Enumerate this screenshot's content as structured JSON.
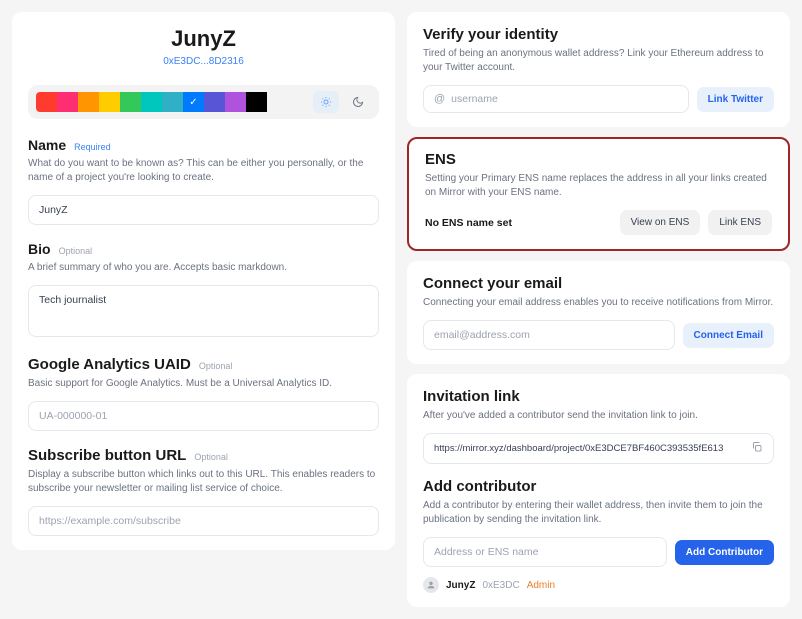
{
  "profile": {
    "display_name": "JunyZ",
    "wallet": "0xE3DC...8D2316"
  },
  "palette": {
    "colors": [
      "#ff3b30",
      "#ff2d72",
      "#ff9500",
      "#ffcc00",
      "#34c759",
      "#00c7be",
      "#30B0C7",
      "#007aff",
      "#5856d6",
      "#af52de",
      "#000000"
    ],
    "selected_index": 7
  },
  "name": {
    "title": "Name",
    "tag": "Required",
    "desc": "What do you want to be known as? This can be either you personally, or the name of a project you're looking to create.",
    "value": "JunyZ"
  },
  "bio": {
    "title": "Bio",
    "tag": "Optional",
    "desc": "A brief summary of who you are. Accepts basic markdown.",
    "value": "Tech journalist"
  },
  "ga": {
    "title": "Google Analytics UAID",
    "tag": "Optional",
    "desc": "Basic support for Google Analytics. Must be a Universal Analytics ID.",
    "placeholder": "UA-000000-01"
  },
  "sub": {
    "title": "Subscribe button URL",
    "tag": "Optional",
    "desc": "Display a subscribe button which links out to this URL. This enables readers to subscribe your newsletter or mailing list service of choice.",
    "placeholder": "https://example.com/subscribe"
  },
  "verify": {
    "title": "Verify your identity",
    "desc": "Tired of being an anonymous wallet address? Link your Ethereum address to your Twitter account.",
    "placeholder": "username",
    "button": "Link Twitter"
  },
  "ens": {
    "title": "ENS",
    "desc": "Setting your Primary ENS name replaces the address in all your links created on Mirror with your ENS name.",
    "status": "No ENS name set",
    "view_btn": "View on ENS",
    "link_btn": "Link ENS"
  },
  "email": {
    "title": "Connect your email",
    "desc": "Connecting your email address enables you to receive notifications from Mirror.",
    "placeholder": "email@address.com",
    "button": "Connect Email"
  },
  "invite": {
    "title": "Invitation link",
    "desc": "After you've added a contributor send the invitation link to join.",
    "url": "https://mirror.xyz/dashboard/project/0xE3DCE7BF460C393535fE613"
  },
  "add": {
    "title": "Add contributor",
    "desc": "Add a contributor by entering their wallet address, then invite them to join the publication by sending the invitation link.",
    "placeholder": "Address or ENS name",
    "button": "Add Contributor",
    "existing": {
      "name": "JunyZ",
      "addr": "0xE3DC",
      "role": "Admin"
    }
  }
}
